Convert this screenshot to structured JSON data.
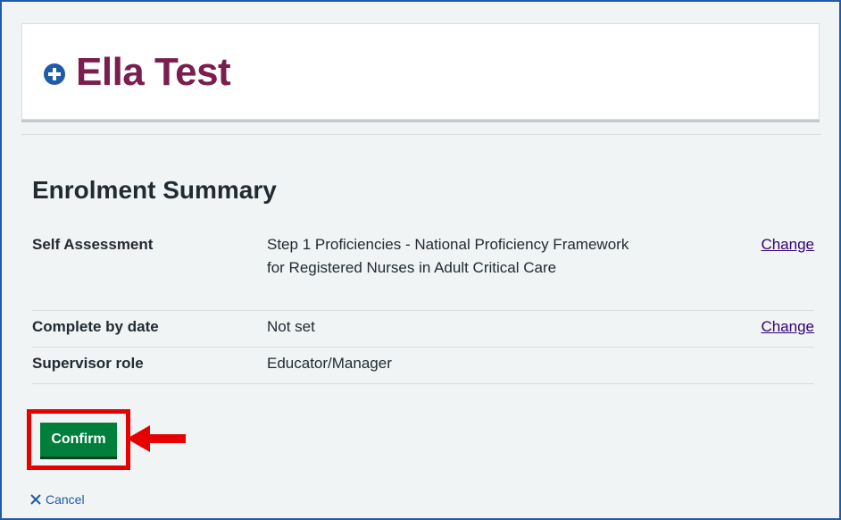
{
  "header": {
    "name": "Ella Test",
    "icon": "plus-circle-icon"
  },
  "page": {
    "heading": "Enrolment Summary"
  },
  "summary": {
    "rows": [
      {
        "key": "Self Assessment",
        "value": "Step 1 Proficiencies - National Proficiency Framework for Registered Nurses in Adult Critical Care",
        "action": "Change"
      },
      {
        "key": "Complete by date",
        "value": "Not set",
        "action": "Change"
      },
      {
        "key": "Supervisor role",
        "value": "Educator/Manager",
        "action": ""
      }
    ]
  },
  "actions": {
    "confirm_label": "Confirm",
    "cancel_label": "Cancel"
  },
  "annotation": {
    "highlight_color": "#e60000",
    "arrow_icon": "left-arrow-icon"
  },
  "colors": {
    "brand_blue": "#1f5ba7",
    "name_color": "#7a1e4f",
    "confirm_green": "#007f3b",
    "link_purple": "#330072"
  }
}
